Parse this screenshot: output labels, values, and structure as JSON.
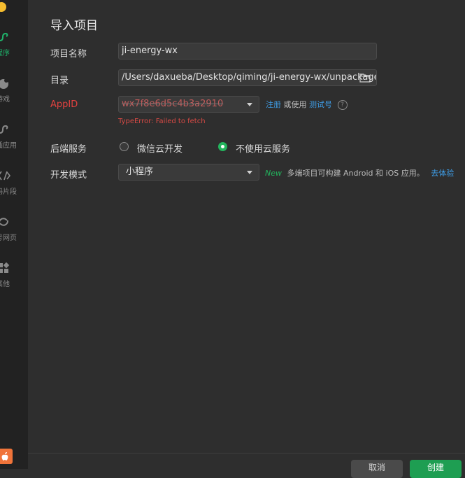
{
  "sidebar": {
    "items": [
      {
        "label": "程序",
        "icon": "miniprogram-icon",
        "active": true
      },
      {
        "label": "游戏",
        "icon": "game-icon",
        "active": false
      },
      {
        "label": "插应用",
        "icon": "plugin-icon",
        "active": false
      },
      {
        "label": "码片段",
        "icon": "code-snippet-icon",
        "active": false
      },
      {
        "label": "号网页",
        "icon": "webpage-icon",
        "active": false
      },
      {
        "label": "其他",
        "icon": "grid-icon",
        "active": false
      }
    ]
  },
  "dialog": {
    "title": "导入项目",
    "project_name": {
      "label": "项目名称",
      "value": "ji-energy-wx"
    },
    "directory": {
      "label": "目录",
      "value": "/Users/daxueba/Desktop/qiming/ji-energy-wx/unpackage/"
    },
    "appid": {
      "label": "AppID",
      "value": "wx7f8e6d5c4b3a2910",
      "register_link": "注册",
      "or_use": "或使用",
      "test_link": "测试号",
      "error": "TypeError: Failed to fetch"
    },
    "backend": {
      "label": "后端服务",
      "options": [
        {
          "label": "微信云开发",
          "selected": false
        },
        {
          "label": "不使用云服务",
          "selected": true
        }
      ]
    },
    "dev_mode": {
      "label": "开发模式",
      "value": "小程序",
      "new_tag": "New",
      "hint": "多端项目可构建 Android 和 iOS 应用。",
      "try_link": "去体验"
    },
    "buttons": {
      "cancel": "取消",
      "create": "创建"
    }
  },
  "colors": {
    "accent_green": "#1fb36b",
    "error_red": "#e0413f",
    "link_blue": "#3f9ee8"
  }
}
